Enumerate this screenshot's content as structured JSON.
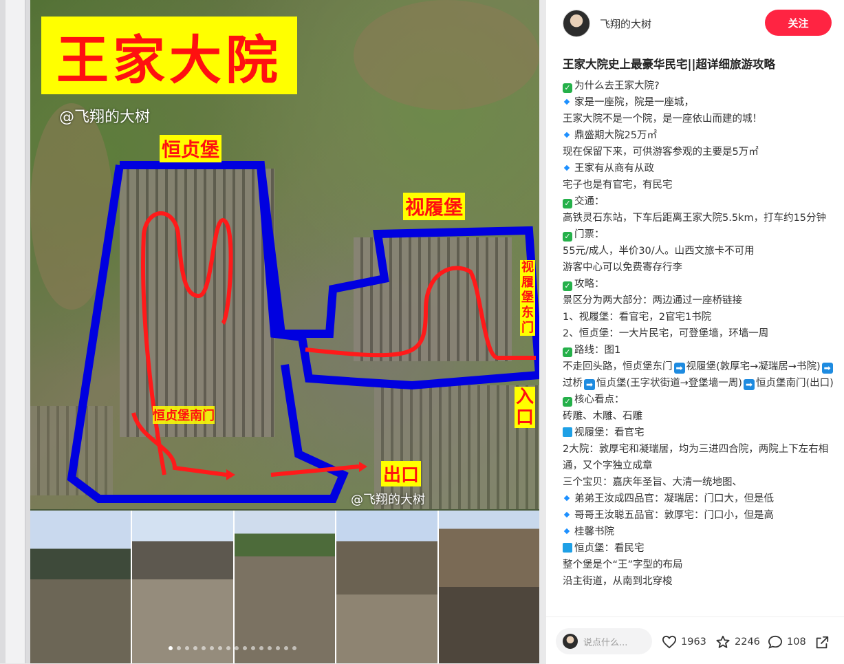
{
  "image_panel": {
    "title_text": "王家大院",
    "watermark": "@飞翔的大树",
    "labels": {
      "hengzhenbao": "恒贞堡",
      "shilvbao": "视履堡",
      "shilvbao_east_gate": "视履堡东门",
      "hengzhenbao_south_gate": "恒贞堡南门",
      "entrance": "入口",
      "exit": "出口"
    },
    "carousel_total": 16,
    "carousel_active": 0
  },
  "author": {
    "name": "飞翔的大树",
    "follow_label": "关注"
  },
  "post": {
    "title": "王家大院史上最豪华民宅||超详细旅游攻略",
    "lines": [
      {
        "icon": "check",
        "text": "为什么去王家大院?"
      },
      {
        "icon": "diamond",
        "text": "家是一座院，院是一座城，"
      },
      {
        "icon": "",
        "text": "王家大院不是一个院，是一座依山而建的城！"
      },
      {
        "icon": "diamond",
        "text": "鼎盛期大院25万㎡"
      },
      {
        "icon": "",
        "text": "现在保留下来，可供游客参观的主要是5万㎡"
      },
      {
        "icon": "diamond",
        "text": "王家有从商有从政"
      },
      {
        "icon": "",
        "text": "宅子也是有官宅，有民宅"
      },
      {
        "icon": "check",
        "text": "交通："
      },
      {
        "icon": "",
        "text": "高铁灵石东站，下车后距离王家大院5.5km，打车约15分钟"
      },
      {
        "icon": "check",
        "text": "门票："
      },
      {
        "icon": "",
        "text": "55元/成人，半价30/人。山西文旅卡不可用"
      },
      {
        "icon": "",
        "text": "游客中心可以免费寄存行李"
      },
      {
        "icon": "check",
        "text": "攻略："
      },
      {
        "icon": "",
        "text": "景区分为两大部分：两边通过一座桥链接"
      },
      {
        "icon": "",
        "text": "1、视履堡：看官宅，2官宅1书院"
      },
      {
        "icon": "",
        "text": "2、恒贞堡：一大片民宅，可登堡墙，环墙一周"
      },
      {
        "icon": "check",
        "text": "路线：图1"
      },
      {
        "icon": "route",
        "text": ""
      },
      {
        "icon": "check",
        "text": "核心看点："
      },
      {
        "icon": "",
        "text": "砖雕、木雕、石雕"
      },
      {
        "icon": "square",
        "text": "视履堡：看官宅"
      },
      {
        "icon": "",
        "text": "2大院：敦厚宅和凝瑞居，均为三进四合院，两院上下左右相通，又个字独立成章"
      },
      {
        "icon": "",
        "text": "三个宝贝：嘉庆年圣旨、大清一统地图、"
      },
      {
        "icon": "diamond",
        "text": "弟弟王汝成四品官：凝瑞居：门口大，但是低"
      },
      {
        "icon": "diamond",
        "text": "哥哥王汝聪五品官：敦厚宅：门口小，但是高"
      },
      {
        "icon": "diamond",
        "text": "桂馨书院"
      },
      {
        "icon": "square",
        "text": "恒贞堡：看民宅"
      },
      {
        "icon": "",
        "text": "整个堡是个“王”字型的布局"
      },
      {
        "icon": "",
        "text": "沿主街道，从南到北穿梭"
      }
    ],
    "route_segments": [
      "不走回头路，恒贞堡东门",
      "视履堡(敦厚宅→凝瑞居→书院)",
      "过桥",
      "恒贞堡(王字状街道→登堡墙一周)",
      "恒贞堡南门(出口)"
    ]
  },
  "footer": {
    "comment_placeholder": "说点什么...",
    "likes": "1963",
    "collects": "2246",
    "comments": "108"
  }
}
